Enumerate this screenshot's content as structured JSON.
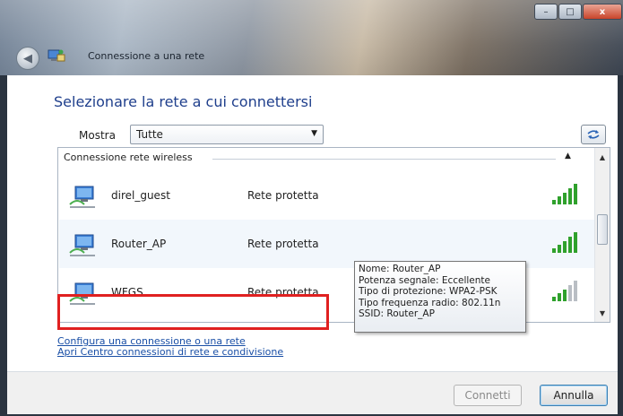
{
  "window": {
    "title": "Connessione a una rete",
    "caption": {
      "minimize_glyph": "–",
      "maximize_glyph": "□",
      "close_glyph": "x"
    },
    "back_glyph": "◀"
  },
  "main": {
    "heading": "Selezionare la rete a cui connettersi",
    "show_label": "Mostra",
    "show_value": "Tutte",
    "group_header": "Connessione rete wireless",
    "networks": [
      {
        "name": "direl_guest",
        "security": "Rete protetta",
        "signal_bars": 5,
        "signal_color": "#2fa12c"
      },
      {
        "name": "Router_AP",
        "security": "Rete protetta",
        "signal_bars": 5,
        "signal_color": "#2fa12c"
      },
      {
        "name": "WFGS",
        "security": "Rete protetta",
        "signal_bars": 3,
        "signal_color": "#2fa12c"
      }
    ],
    "tooltip": [
      "Nome: Router_AP",
      "Potenza segnale: Eccellente",
      "Tipo di protezione: WPA2-PSK",
      "Tipo frequenza radio: 802.11n",
      "SSID: Router_AP"
    ],
    "links": {
      "configure": "Configura una connessione o una rete",
      "open_center": "Apri Centro connessioni di rete e condivisione"
    }
  },
  "footer": {
    "connect_label": "Connetti",
    "cancel_label": "Annulla"
  },
  "colors": {
    "heading": "#1f3f8c",
    "link": "#1a4fa6",
    "highlight": "#e02020",
    "signal": "#2fa12c"
  },
  "icons": {
    "network": "wireless-network-icon",
    "signal": "signal-strength-icon",
    "refresh": "refresh-icon",
    "back": "back-arrow-icon"
  }
}
